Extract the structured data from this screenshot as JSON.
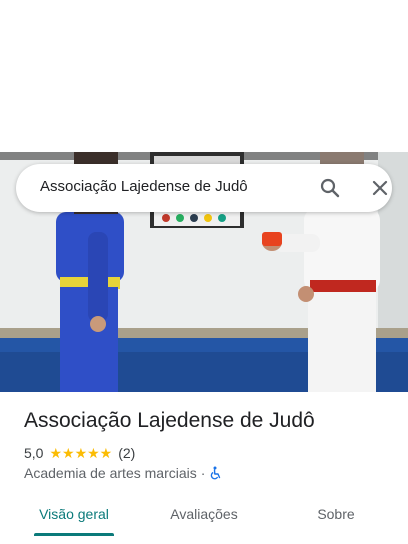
{
  "search": {
    "query": "Associação Lajedense de Judô"
  },
  "place": {
    "title": "Associação Lajedense de Judô",
    "rating": "5,0",
    "stars": "★★★★★",
    "review_count": "(2)",
    "category": "Academia de artes marciais",
    "separator": "·"
  },
  "tabs": [
    {
      "label": "Visão geral",
      "active": true
    },
    {
      "label": "Avaliações",
      "active": false
    },
    {
      "label": "Sobre",
      "active": false
    }
  ],
  "colors": {
    "accent": "#0b7a7a",
    "star": "#fbbc04",
    "accessibility": "#1a73e8"
  },
  "icons": {
    "search": "search-icon",
    "close": "close-icon",
    "accessibility": "wheelchair-icon"
  }
}
